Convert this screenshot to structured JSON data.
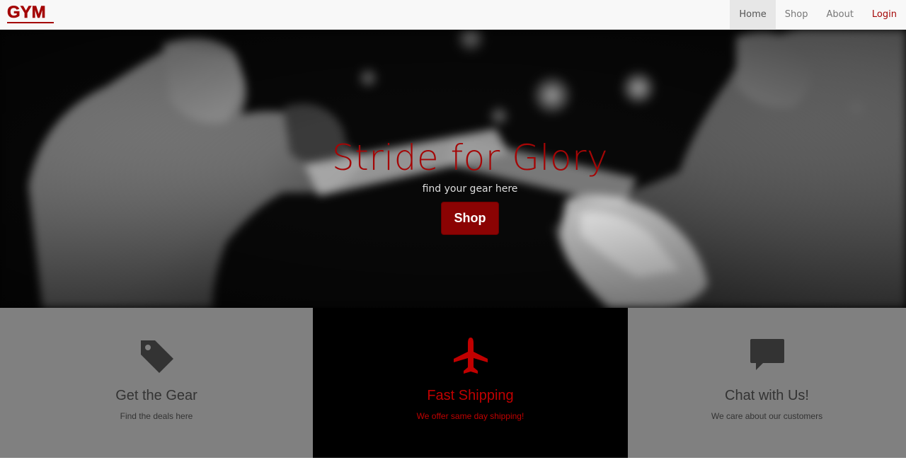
{
  "navbar": {
    "brand": "GYM",
    "items": [
      {
        "label": "Home",
        "active": true
      },
      {
        "label": "Shop",
        "active": false
      },
      {
        "label": "About",
        "active": false
      },
      {
        "label": "Login",
        "active": false
      }
    ]
  },
  "hero": {
    "title": "Stride for Glory",
    "subtitle": "find your gear here",
    "button_label": "Shop"
  },
  "features": [
    {
      "icon": "tag-icon",
      "title": "Get the Gear",
      "text": "Find the deals here"
    },
    {
      "icon": "airplane-icon",
      "title": "Fast Shipping",
      "text": "We offer same day shipping!"
    },
    {
      "icon": "chat-bubble-icon",
      "title": "Chat with Us!",
      "text": "We care about our customers"
    }
  ],
  "colors": {
    "accent": "#a40606",
    "button": "#8b0303",
    "navbar_bg": "#f8f8f8",
    "feature_gray": "#808080",
    "feature_dark": "#000000",
    "feature_highlight_text": "#c00000"
  }
}
